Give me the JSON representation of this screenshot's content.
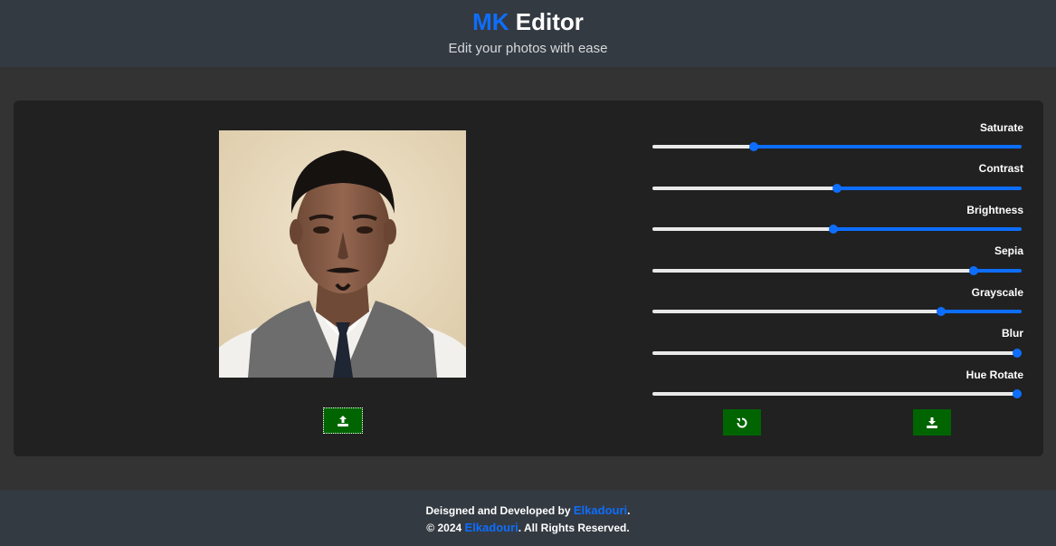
{
  "header": {
    "brand": "MK",
    "title_rest": " Editor",
    "subtitle": "Edit your photos with ease"
  },
  "editor": {
    "upload_icon": "upload-icon",
    "filters": [
      {
        "label": "Saturate",
        "value": 0.27
      },
      {
        "label": "Contrast",
        "value": 0.5
      },
      {
        "label": "Brightness",
        "value": 0.49
      },
      {
        "label": "Sepia",
        "value": 0.88
      },
      {
        "label": "Grayscale",
        "value": 0.79
      },
      {
        "label": "Blur",
        "value": 1.0
      },
      {
        "label": "Hue Rotate",
        "value": 1.0
      }
    ],
    "reset_icon": "reset-icon",
    "download_icon": "download-icon"
  },
  "footer": {
    "line1_prefix": "Deisgned and Developed by ",
    "line1_link": "Elkadouri",
    "line1_suffix": ".",
    "line2_prefix": "© 2024 ",
    "line2_link": "Elkadouri",
    "line2_suffix": ". All Rights Reserved."
  },
  "colors": {
    "accent": "#0d6efd",
    "button": "#006400",
    "header_bg": "#343a42",
    "page_bg": "#333333",
    "panel_bg": "#212121"
  }
}
